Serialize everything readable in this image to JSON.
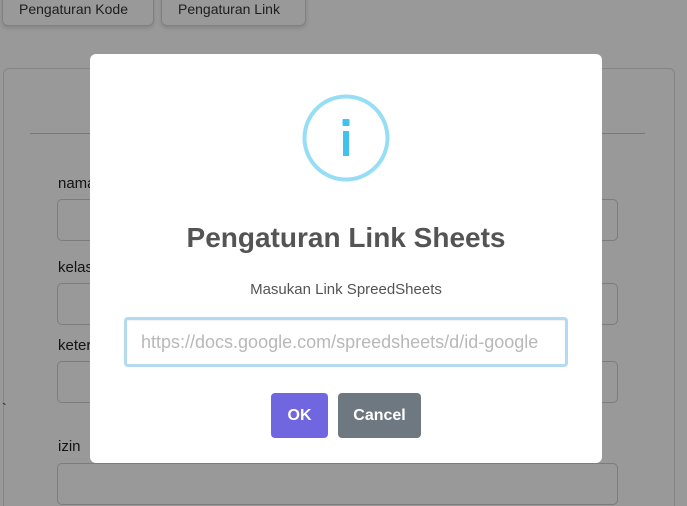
{
  "background": {
    "tabs": [
      {
        "label": "Pengaturan Kode"
      },
      {
        "label": "Pengaturan Link"
      }
    ],
    "form": {
      "fields": [
        {
          "label": "nama"
        },
        {
          "label": "kelas"
        },
        {
          "label": "keterangan"
        },
        {
          "label": "izin"
        }
      ],
      "stray_mark": "`"
    }
  },
  "modal": {
    "icon": "info-icon",
    "icon_glyph": "i",
    "icon_color": "#3fc3ee",
    "title": "Pengaturan Link Sheets",
    "subtitle": "Masukan Link SpreedSheets",
    "input": {
      "value": "",
      "placeholder": "https://docs.google.com/spreedsheets/d/id-google"
    },
    "buttons": {
      "ok_label": "OK",
      "ok_color": "#7066e0",
      "cancel_label": "Cancel",
      "cancel_color": "#6e7881"
    }
  }
}
